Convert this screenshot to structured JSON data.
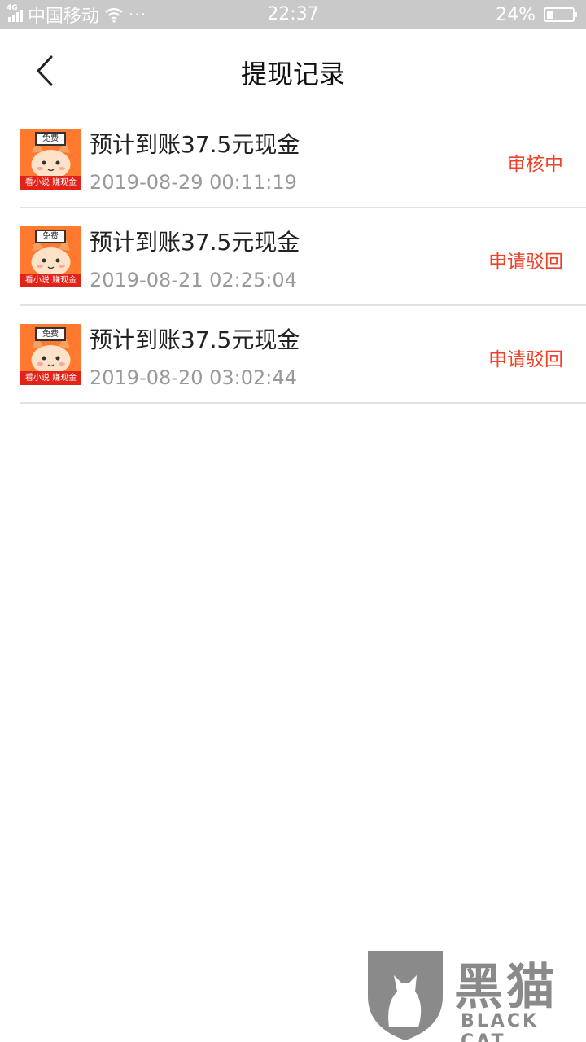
{
  "status_bar": {
    "network_tag": "4G",
    "carrier": "中国移动",
    "dots": "···",
    "time": "22:37",
    "battery_percent_text": "24%",
    "battery_level": 0.24
  },
  "header": {
    "title": "提现记录"
  },
  "app_icon": {
    "badge_text": "免费",
    "ribbon_text": "看小说 赚现金"
  },
  "records": [
    {
      "title": "预计到账37.5元现金",
      "time": "2019-08-29 00:11:19",
      "status": "审核中"
    },
    {
      "title": "预计到账37.5元现金",
      "time": "2019-08-21 02:25:04",
      "status": "申请驳回"
    },
    {
      "title": "预计到账37.5元现金",
      "time": "2019-08-20 03:02:44",
      "status": "申请驳回"
    }
  ],
  "watermark": {
    "cn": "黑猫",
    "en": "BLACK CAT"
  },
  "colors": {
    "status_text": "#f0412a",
    "status_bar_bg": "#c9c9c9",
    "icon_bg": "#ff7a2e"
  }
}
